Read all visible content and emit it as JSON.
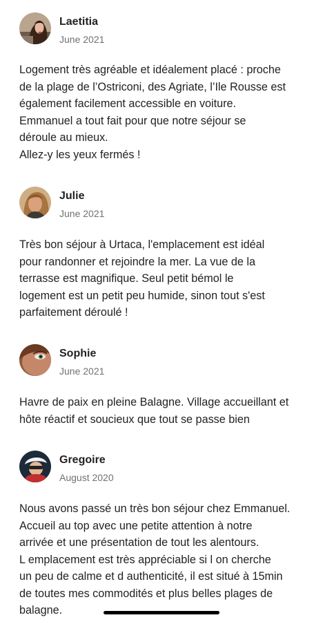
{
  "reviews": [
    {
      "author": "Laetitia",
      "date": "June 2021",
      "avatar_icon": "profile-photo",
      "text": "Logement très agréable et idéalement placé : proche\nde la plage de l’Ostriconi, des Agriate, l’Ile Rousse est\négalement facilement accessible en voiture.\nEmmanuel a tout fait pour que notre séjour se\ndéroule au mieux.\nAllez-y les yeux fermés !"
    },
    {
      "author": "Julie",
      "date": "June 2021",
      "avatar_icon": "profile-photo",
      "text": "Très bon séjour à Urtaca, l'emplacement est idéal\npour randonner et rejoindre la mer. La vue de la\nterrasse est magnifique. Seul petit bémol le\nlogement est un petit peu humide, sinon tout s'est\nparfaitement déroulé !"
    },
    {
      "author": "Sophie",
      "date": "June 2021",
      "avatar_icon": "profile-photo",
      "text": "Havre de paix en pleine Balagne. Village accueillant et\nhôte réactif et soucieux que tout se passe bien"
    },
    {
      "author": "Gregoire",
      "date": "August 2020",
      "avatar_icon": "profile-photo",
      "text": "Nous avons passé un très bon séjour chez Emmanuel.\nAccueil au top avec une petite attention à notre\narrivée et une présentation de tout les alentours.\nL emplacement est très appréciable si l on cherche\nun peu de calme et d authenticité, il est situé à 15min\nde toutes mes commodités et plus belles plages de\nbalagne."
    }
  ]
}
